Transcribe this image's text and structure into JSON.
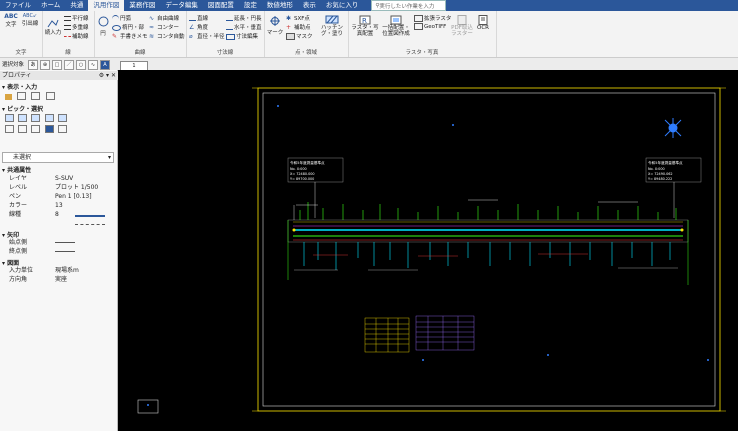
{
  "menu": {
    "items": [
      "ファイル",
      "ホーム",
      "共通",
      "汎用作図",
      "業務作図",
      "データ編集",
      "図面配置",
      "設定",
      "数値地形",
      "表示",
      "お気に入り"
    ],
    "active_index": 3,
    "search_placeholder": "実行したい作業を入力"
  },
  "ribbon": {
    "groups": {
      "text": {
        "label": "文字",
        "btn_text": "文字",
        "btn_leader": "引出線"
      },
      "line": {
        "label": "線",
        "btn_parallel": "平行線",
        "btn_multi": "多重線",
        "btn_aux": "補助線",
        "btn_continuous": "続入力"
      },
      "curve": {
        "label": "曲線",
        "btn_circle": "円",
        "btn_arc": "円弧",
        "btn_ellipse": "楕円・部",
        "btn_freehand": "手書きメモ",
        "btn_free_curve": "自由曲線",
        "btn_cornu": "コンター",
        "btn_cornu_auto": "コンタ自動"
      },
      "dimension": {
        "label": "寸法線",
        "btn_dir": "直線",
        "btn_angle": "角度",
        "btn_radius": "直径・半径",
        "btn_extend": "延長・円長",
        "btn_horizontal": "水平・垂直",
        "btn_dim_edit": "寸法編集"
      },
      "point": {
        "label": "点・領域",
        "btn_mark": "マーク",
        "btn_sxf": "SXF点",
        "btn_aux_pt": "補助点",
        "btn_mask": "マスク",
        "btn_hatch": "ハッチング・塗り"
      },
      "raster": {
        "label": "ラスタ・写真",
        "btn_raster": "ラスタ・写真配置",
        "btn_batch": "一括配置・位置図作成",
        "btn_ext_raster": "拡張ラスタ",
        "btn_geotiff": "GeoTIFF",
        "btn_pdf": "PDF取込ラスター",
        "btn_ocr": "OCR"
      }
    }
  },
  "tab2": {
    "label": "1"
  },
  "panel": {
    "select_label": "選択対象",
    "properties_title": "プロパティ",
    "display_input": "表示・入力",
    "pick_select": "ピック・選択",
    "dropdown_value": "未選択",
    "sec_common": "共通属性",
    "rows": [
      {
        "k": "レイヤ",
        "v": "S-SUV"
      },
      {
        "k": "レベル",
        "v": "プロット 1/500"
      },
      {
        "k": "ペン",
        "v": "Pen 1 [0.13]"
      },
      {
        "k": "カラー",
        "v": "13"
      },
      {
        "k": "線種",
        "v": "8"
      }
    ],
    "sec_arrow": "矢印",
    "arrow_rows": [
      {
        "k": "始点側",
        "v": ""
      },
      {
        "k": "終点側",
        "v": ""
      }
    ],
    "sec_sheet": "図面",
    "sheet_rows": [
      {
        "k": "入力単位",
        "v": "現場系m"
      },
      {
        "k": "方向角",
        "v": "実座"
      }
    ]
  },
  "drawing": {
    "label_left_title": "令和5年度測量基準点",
    "label_left_lines": [
      "No.    X:000",
      "X= 72480.000",
      "Y= 89700.000"
    ],
    "label_right_title": "令和5年度測量基準点",
    "label_right_lines": [
      "No.    X:000",
      "X= 72490.062",
      "Y= 89480.222"
    ]
  },
  "colors": {
    "ribbon_blue": "#2b579a",
    "cyan": "#00e5ff",
    "green": "#39ff14",
    "yellow": "#ffe600",
    "purple": "#9b6cff",
    "white": "#ffffff"
  }
}
